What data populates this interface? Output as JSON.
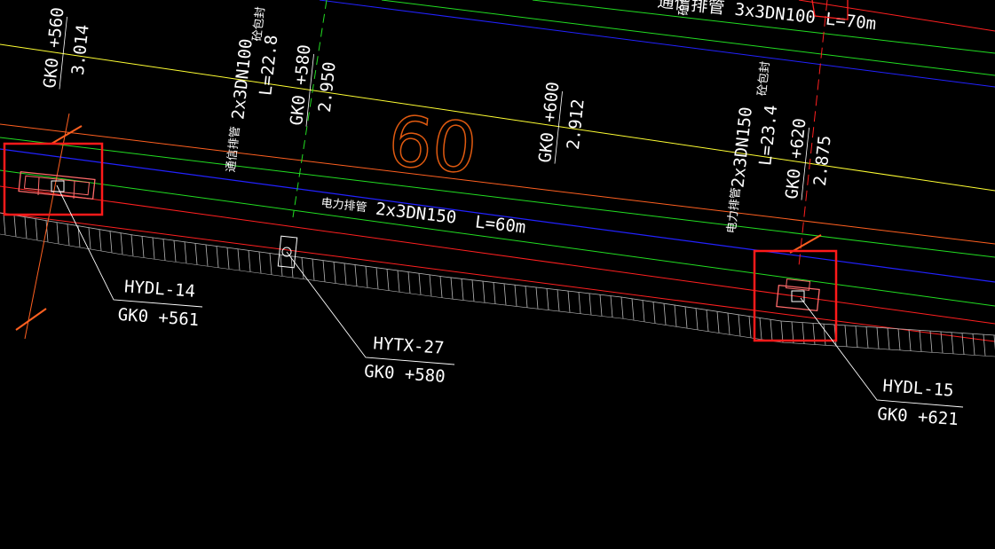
{
  "drawing": {
    "background_color": "#000000",
    "colors": {
      "yellow_line": "#ffff33",
      "green_line": "#22dd22",
      "blue_line": "#2222ff",
      "red_line": "#ff2020",
      "orange_line": "#ff6020",
      "wall_hatch": "#b8b8b8",
      "text": "#ffffff",
      "highlight_box": "#ff1a1a",
      "big_number": "#e05a10"
    },
    "top_pipe_label": "通信排管 3x3DN100 L=70m",
    "top_pipe_tag": "砼包封",
    "stations": {
      "s560": {
        "name": "GK0 +560",
        "elev": "3.014"
      },
      "s580": {
        "name": "GK0 +580",
        "elev": "2.950"
      },
      "s600": {
        "name": "GK0 +600",
        "elev": "2.912"
      },
      "s620": {
        "name": "GK0 +620",
        "elev": "2.875"
      }
    },
    "comm_pipe": {
      "label": "通信排管",
      "spec": "2x3DN100",
      "length": "L=22.8",
      "tag": "砼包封"
    },
    "power_pipe_right": {
      "label": "电力排管",
      "spec": "2x3DN150",
      "length": "L=23.4",
      "tag": "砼包封"
    },
    "power_pipe_main": {
      "label": "电力排管",
      "spec": "2x3DN150",
      "length": "L=60m"
    },
    "big_number": "60",
    "wells": [
      {
        "id": "HYDL-14",
        "station": "GK0 +561"
      },
      {
        "id": "HYTX-27",
        "station": "GK0 +580"
      },
      {
        "id": "HYDL-15",
        "station": "GK0 +621"
      }
    ]
  }
}
